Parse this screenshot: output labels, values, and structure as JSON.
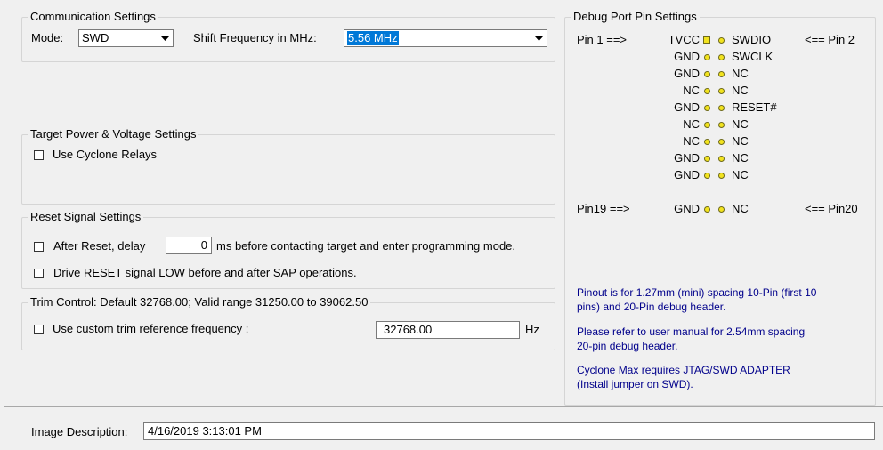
{
  "communication": {
    "legend": "Communication Settings",
    "mode_label": "Mode:",
    "mode_value": "SWD",
    "shift_label": "Shift Frequency in MHz:",
    "shift_value": "5.56 MHz"
  },
  "target_power": {
    "legend": "Target Power & Voltage Settings",
    "use_relays_label": "Use Cyclone Relays"
  },
  "reset": {
    "legend": "Reset Signal Settings",
    "after_reset_label": "After Reset, delay",
    "delay_value": "0",
    "delay_suffix": "ms before contacting target and enter programming mode.",
    "drive_reset_label": "Drive RESET signal LOW before and after SAP operations."
  },
  "trim": {
    "legend": "Trim Control: Default 32768.00; Valid range 31250.00 to 39062.50",
    "custom_label": "Use custom trim reference frequency :",
    "value": "32768.00",
    "unit": "Hz"
  },
  "debug": {
    "legend": "Debug Port Pin Settings",
    "pin1_label": "Pin 1 ==>",
    "pin2_label": "<== Pin 2",
    "pin19_label": "Pin19 ==>",
    "pin20_label": "<== Pin20",
    "rows": [
      {
        "left": "TVCC",
        "right": "SWDIO"
      },
      {
        "left": "GND",
        "right": "SWCLK"
      },
      {
        "left": "GND",
        "right": "NC"
      },
      {
        "left": "NC",
        "right": "NC"
      },
      {
        "left": "GND",
        "right": "RESET#"
      },
      {
        "left": "NC",
        "right": "NC"
      },
      {
        "left": "NC",
        "right": "NC"
      },
      {
        "left": "GND",
        "right": "NC"
      },
      {
        "left": "GND",
        "right": "NC"
      },
      {
        "left": "GND",
        "right": "NC"
      }
    ],
    "note1_line1": "Pinout is for 1.27mm (mini) spacing 10-Pin (first 10",
    "note1_line2": "pins) and 20-Pin debug header.",
    "note2_line1": "Please refer to user manual for 2.54mm spacing",
    "note2_line2": "20-pin debug header.",
    "note3_line1": "Cyclone Max requires JTAG/SWD ADAPTER",
    "note3_line2": "(Install jumper on SWD)."
  },
  "image_description": {
    "label": "Image Description:",
    "value": "4/16/2019 3:13:01 PM"
  },
  "colors": {
    "pin_marker": "#f2e31e",
    "note_text": "#00008b",
    "selection": "#0078d7"
  }
}
